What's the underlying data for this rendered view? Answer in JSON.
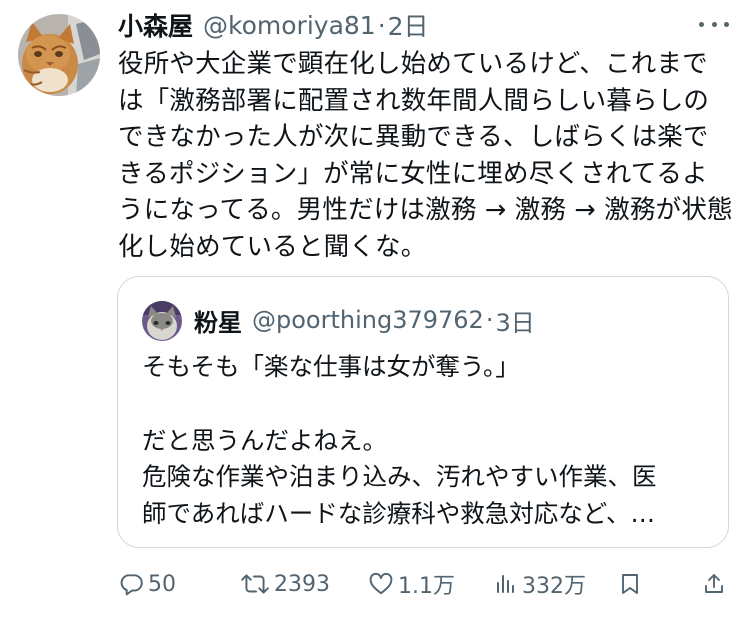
{
  "tweet": {
    "display_name": "小森屋",
    "handle": "@komoriya81",
    "separator": "·",
    "time": "2日",
    "text": "役所や大企業で顕在化し始めているけど、これまで\nは「激務部署に配置され数年間人間らしい暮らしの\nできなかった人が次に異動できる、しばらくは楽で\nきるポジション」が常に女性に埋め尽くされてるよ\nうになってる。男性だけは激務 → 激務 → 激務が状態\n化し始めていると聞くな。"
  },
  "quote": {
    "display_name": "粉星",
    "handle": "@poorthing379762",
    "separator": "·",
    "time": "3日",
    "text": "そもそも「楽な仕事は女が奪う。」\n\nだと思うんだよねえ。\n危険な作業や泊まり込み、汚れやすい作業、医\n師であればハードな診療科や救急対応など、…"
  },
  "actions": {
    "reply": {
      "icon": "reply-icon",
      "count": "50"
    },
    "retweet": {
      "icon": "retweet-icon",
      "count": "2393"
    },
    "like": {
      "icon": "heart-icon",
      "count": "1.1万"
    },
    "views": {
      "icon": "views-icon",
      "count": "332万"
    },
    "bookmark": {
      "icon": "bookmark-icon"
    },
    "share": {
      "icon": "share-icon"
    }
  },
  "colors": {
    "text": "#0f1419",
    "secondary": "#536471",
    "border": "#cfd9de"
  }
}
